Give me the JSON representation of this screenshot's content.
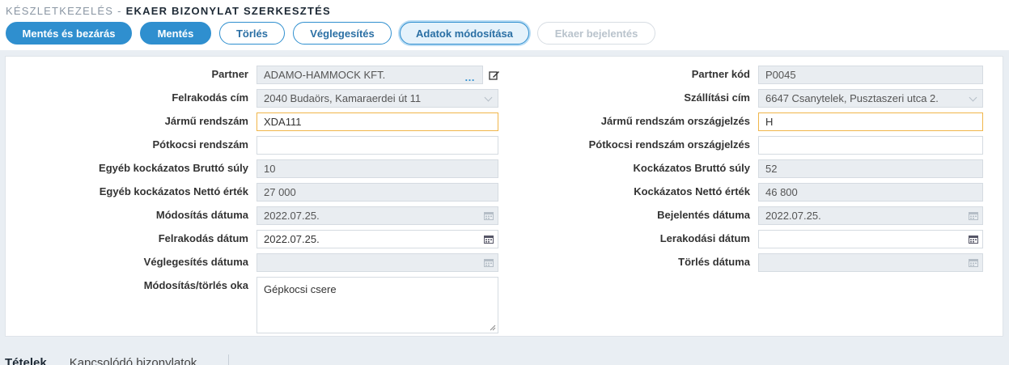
{
  "header": {
    "breadcrumb_section": "Készletkezelés",
    "breadcrumb_separator": "-",
    "title": "EKAER bizonylat szerkesztés"
  },
  "toolbar": {
    "save_close": "Mentés és bezárás",
    "save": "Mentés",
    "delete": "Törlés",
    "finalize": "Véglegesítés",
    "modify_data": "Adatok módosítása",
    "ekaer_report": "Ekaer bejelentés"
  },
  "form": {
    "left": {
      "partner": {
        "label": "Partner",
        "value": "ADAMO-HAMMOCK KFT."
      },
      "loading_address": {
        "label": "Felrakodás cím",
        "value": "2040 Budaörs, Kamaraerdei út 11"
      },
      "vehicle_plate": {
        "label": "Jármű rendszám",
        "value": "XDA111"
      },
      "trailer_plate": {
        "label": "Pótkocsi rendszám",
        "value": ""
      },
      "other_gross_weight": {
        "label": "Egyéb kockázatos Bruttó súly",
        "value": "10"
      },
      "other_net_value": {
        "label": "Egyéb kockázatos Nettó érték",
        "value": "27 000"
      },
      "modification_date": {
        "label": "Módosítás dátuma",
        "value": "2022.07.25."
      },
      "loading_date": {
        "label": "Felrakodás dátum",
        "value": "2022.07.25."
      },
      "finalization_date": {
        "label": "Véglegesítés dátuma",
        "value": ""
      },
      "reason": {
        "label": "Módosítás/törlés oka",
        "value": "Gépkocsi csere"
      }
    },
    "right": {
      "partner_code": {
        "label": "Partner kód",
        "value": "P0045"
      },
      "shipping_address": {
        "label": "Szállítási cím",
        "value": "6647 Csanytelek, Pusztaszeri utca 2."
      },
      "vehicle_country": {
        "label": "Jármű rendszám országjelzés",
        "value": "H"
      },
      "trailer_country": {
        "label": "Pótkocsi rendszám országjelzés",
        "value": ""
      },
      "risky_gross_weight": {
        "label": "Kockázatos Bruttó súly",
        "value": "52"
      },
      "risky_net_value": {
        "label": "Kockázatos Nettó érték",
        "value": "46 800"
      },
      "report_date": {
        "label": "Bejelentés dátuma",
        "value": "2022.07.25."
      },
      "unloading_date": {
        "label": "Lerakodási dátum",
        "value": ""
      },
      "deletion_date": {
        "label": "Törlés dátuma",
        "value": ""
      }
    }
  },
  "tabs": [
    "Tételek",
    "Kapcsolódó bizonylatok"
  ],
  "icons": {
    "partner_browse": "ellipsis-icon",
    "partner_edit": "edit-icon",
    "date": "calendar-icon"
  },
  "colors": {
    "primary": "#2f8fcf",
    "focus_border": "#f0b64a",
    "readonly_bg": "#e9edf1"
  }
}
